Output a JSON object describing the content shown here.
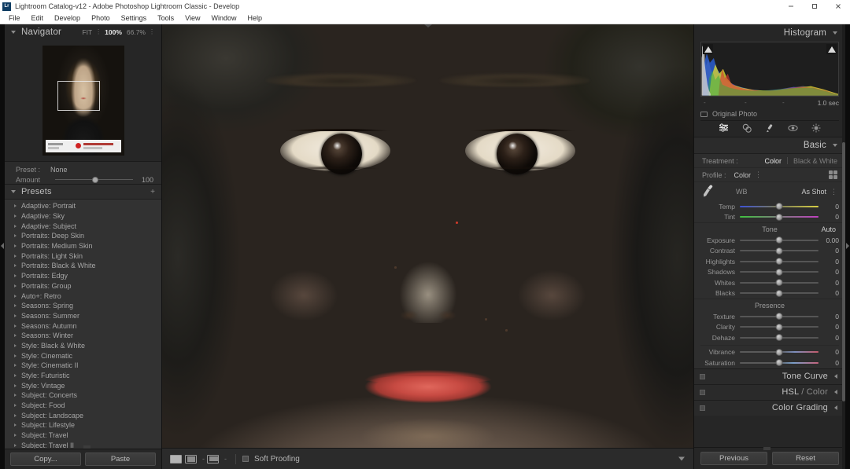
{
  "titlebar": {
    "app_badge": "Lr",
    "title": "Lightroom Catalog-v12 - Adobe Photoshop Lightroom Classic - Develop",
    "minimize": "—",
    "maximize": "⬜",
    "close": "✕"
  },
  "menubar": {
    "items": [
      "File",
      "Edit",
      "Develop",
      "Photo",
      "Settings",
      "Tools",
      "View",
      "Window",
      "Help"
    ]
  },
  "left_panel": {
    "navigator": {
      "title": "Navigator",
      "zoom_levels": [
        "FIT",
        "100%",
        "66.7%"
      ],
      "active_zoom": "100%",
      "more_dots": "⋮"
    },
    "preset_row": {
      "preset_label": "Preset :",
      "preset_value": "None",
      "amount_label": "Amount",
      "amount_value": "100"
    },
    "presets": {
      "title": "Presets",
      "add_icon": "+",
      "items": [
        "Adaptive: Portrait",
        "Adaptive: Sky",
        "Adaptive: Subject",
        "Portraits: Deep Skin",
        "Portraits: Medium Skin",
        "Portraits: Light Skin",
        "Portraits: Black & White",
        "Portraits: Edgy",
        "Portraits: Group",
        "Auto+: Retro",
        "Seasons: Spring",
        "Seasons: Summer",
        "Seasons: Autumn",
        "Seasons: Winter",
        "Style: Black & White",
        "Style: Cinematic",
        "Style: Cinematic II",
        "Style: Futuristic",
        "Style: Vintage",
        "Subject: Concerts",
        "Subject: Food",
        "Subject: Landscape",
        "Subject: Lifestyle",
        "Subject: Travel",
        "Subject: Travel II"
      ]
    },
    "buttons": {
      "copy": "Copy...",
      "paste": "Paste"
    }
  },
  "toolbar": {
    "view_loupe": "loupe-view-icon",
    "view_compare": "compare-view-icon",
    "view_survey": "survey-view-icon",
    "soft_proofing_label": "Soft Proofing",
    "soft_proofing_checked": false,
    "separator_dots": "-"
  },
  "right_panel": {
    "histogram": {
      "title": "Histogram",
      "exposure_readout": "1.0 sec",
      "ticks": [
        "-",
        "-",
        "-"
      ],
      "original_photo_label": "Original Photo"
    },
    "tools": [
      {
        "name": "crop-tool-icon",
        "glyph": "☰",
        "active": true
      },
      {
        "name": "healing-brush-icon",
        "glyph": "❁",
        "active": false
      },
      {
        "name": "adjustment-brush-icon",
        "glyph": "✎",
        "active": false
      },
      {
        "name": "red-eye-tool-icon",
        "glyph": "◉",
        "active": false
      },
      {
        "name": "masking-tool-icon",
        "glyph": "☀",
        "active": false
      }
    ],
    "basic": {
      "title": "Basic",
      "treatment_label": "Treatment :",
      "treatment_color": "Color",
      "treatment_bw": "Black & White",
      "treatment_selected": "Color",
      "profile_label": "Profile :",
      "profile_value": "Color",
      "wb_label": "WB",
      "wb_value": "As Shot",
      "sliders_wb": [
        {
          "name": "Temp",
          "value": "0",
          "pos": 50,
          "grad": "grad-temp"
        },
        {
          "name": "Tint",
          "value": "0",
          "pos": 50,
          "grad": "grad-tint"
        }
      ],
      "tone_label": "Tone",
      "auto_label": "Auto",
      "sliders_tone": [
        {
          "name": "Exposure",
          "value": "0.00",
          "pos": 50,
          "grad": ""
        },
        {
          "name": "Contrast",
          "value": "0",
          "pos": 50,
          "grad": ""
        },
        {
          "name": "Highlights",
          "value": "0",
          "pos": 50,
          "grad": ""
        },
        {
          "name": "Shadows",
          "value": "0",
          "pos": 50,
          "grad": ""
        },
        {
          "name": "Whites",
          "value": "0",
          "pos": 50,
          "grad": ""
        },
        {
          "name": "Blacks",
          "value": "0",
          "pos": 50,
          "grad": ""
        }
      ],
      "presence_label": "Presence",
      "sliders_presence": [
        {
          "name": "Texture",
          "value": "0",
          "pos": 50,
          "grad": ""
        },
        {
          "name": "Clarity",
          "value": "0",
          "pos": 50,
          "grad": ""
        },
        {
          "name": "Dehaze",
          "value": "0",
          "pos": 50,
          "grad": ""
        }
      ],
      "sliders_color": [
        {
          "name": "Vibrance",
          "value": "0",
          "pos": 50,
          "grad": "grad-vib"
        },
        {
          "name": "Saturation",
          "value": "0",
          "pos": 50,
          "grad": "grad-sat"
        }
      ]
    },
    "collapsed_panels": [
      {
        "title": "Tone Curve",
        "dim": ""
      },
      {
        "title": "HSL",
        "dim": " / Color"
      },
      {
        "title": "Color Grading",
        "dim": ""
      }
    ],
    "buttons": {
      "previous": "Previous",
      "reset": "Reset"
    }
  },
  "colors": {
    "chrome": "#262626",
    "panel": "#2e2e2e",
    "accent_text": "#e8e8e8",
    "titlebar_bg": "#ffffff",
    "lips": "#c74a42"
  }
}
